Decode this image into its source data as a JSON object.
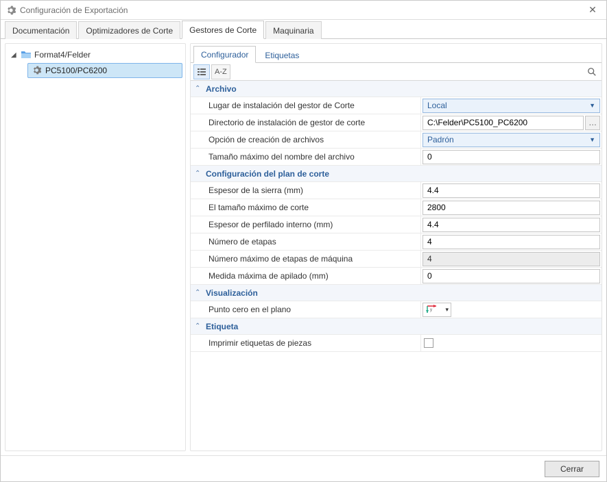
{
  "window": {
    "title": "Configuración de Exportación"
  },
  "main_tabs": {
    "items": [
      {
        "label": "Documentación",
        "active": false
      },
      {
        "label": "Optimizadores de Corte",
        "active": false
      },
      {
        "label": "Gestores de Corte",
        "active": true
      },
      {
        "label": "Maquinaria",
        "active": false
      }
    ]
  },
  "tree": {
    "root_label": "Format4/Felder",
    "child_label": "PC5100/PC6200"
  },
  "sub_tabs": {
    "items": [
      {
        "label": "Configurador",
        "active": true
      },
      {
        "label": "Etiquetas",
        "active": false
      }
    ]
  },
  "toolbar": {
    "sort_label": "A-Z",
    "search_placeholder": ""
  },
  "groups": {
    "archivo": {
      "title": "Archivo",
      "install_location_label": "Lugar de instalación del gestor de Corte",
      "install_location_value": "Local",
      "install_dir_label": "Directorio de instalación de gestor de corte",
      "install_dir_value": "C:\\Felder\\PC5100_PC6200",
      "file_create_option_label": "Opción de creación de archivos",
      "file_create_option_value": "Padrón",
      "max_filename_label": "Tamaño máximo del nombre del archivo",
      "max_filename_value": "0"
    },
    "plan": {
      "title": "Configuración del plan de corte",
      "saw_thickness_label": "Espesor de la sierra (mm)",
      "saw_thickness_value": "4.4",
      "max_cut_size_label": "El tamaño máximo de corte",
      "max_cut_size_value": "2800",
      "internal_profile_thickness_label": "Espesor de perfilado interno (mm)",
      "internal_profile_thickness_value": "4.4",
      "num_stages_label": "Número de etapas",
      "num_stages_value": "4",
      "max_machine_stages_label": "Número máximo de etapas de máquina",
      "max_machine_stages_value": "4",
      "max_stack_label": "Medida máxima de apilado (mm)",
      "max_stack_value": "0"
    },
    "visual": {
      "title": "Visualización",
      "zero_point_label": "Punto cero en el plano"
    },
    "etiqueta": {
      "title": "Etiqueta",
      "print_labels_label": "Imprimir etiquetas de piezas",
      "print_labels_checked": false
    }
  },
  "footer": {
    "close_label": "Cerrar"
  },
  "icons": {
    "gear": "gear-icon",
    "close": "close-icon",
    "folder": "folder-icon",
    "categorized": "categorized-view-icon",
    "search": "search-icon",
    "ellipsis": "ellipsis-icon",
    "origin": "origin-icon",
    "chevron_up": "chevron-up-icon",
    "chevron_right": "chevron-right-icon"
  }
}
